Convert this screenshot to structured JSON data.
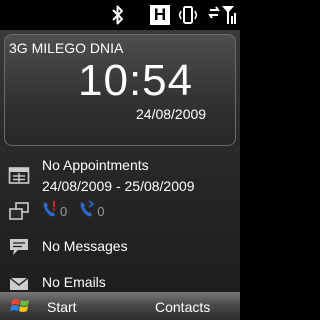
{
  "status_bar": {
    "icons": [
      "bluetooth-icon",
      "hsdpa-icon",
      "vibrate-icon",
      "signal-icon"
    ],
    "network_badge": "H"
  },
  "clock": {
    "carrier": "3G MILEGO DNIA",
    "time": "10:54",
    "date": "24/08/2009"
  },
  "appointments": {
    "icon": "calendar-icon",
    "title": "No Appointments",
    "range": "24/08/2009 - 25/08/2009"
  },
  "calls": {
    "icon": "windows-stack-icon",
    "missed_count": "0",
    "voicemail_count": "0"
  },
  "messages": {
    "icon": "message-bubble-icon",
    "text": "No Messages"
  },
  "emails": {
    "icon": "envelope-icon",
    "text": "No Emails"
  },
  "softkeys": {
    "left": "Start",
    "right": "Contacts"
  },
  "colors": {
    "background": "#000000",
    "panel_border": "#6a6a6a",
    "muted_text": "#9a9a9a",
    "call_red": "#c8321e",
    "call_blue": "#2a6ad0"
  }
}
